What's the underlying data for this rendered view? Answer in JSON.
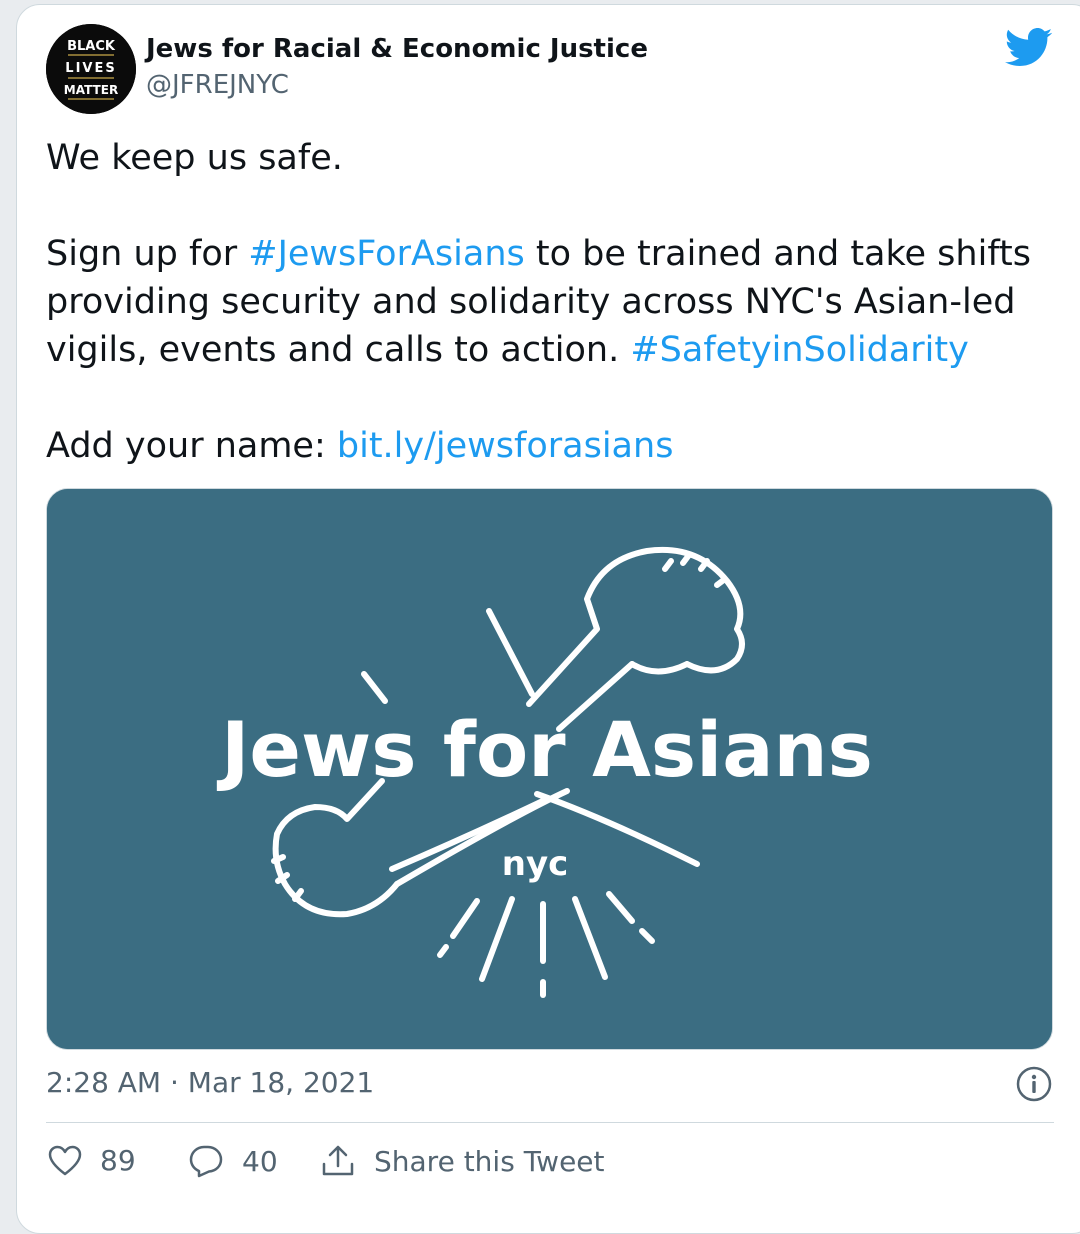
{
  "tweet": {
    "author_name": "Jews for Racial & Economic Justice",
    "author_handle": "@JFREJNYC",
    "avatar_text": [
      "BLACK",
      "LIVES",
      "MATTER"
    ],
    "line1": "We keep us safe.",
    "para2_pre": "Sign up for ",
    "para2_hashtag1": "#JewsForAsians",
    "para2_mid": " to be trained and take shifts",
    "para2_line2": "providing security and solidarity across NYC's Asian-led",
    "para2_line3_pre": "vigils, events and calls to action. ",
    "para2_hashtag2": "#SafetyinSolidarity",
    "add_name_label": "Add your name: ",
    "add_name_link": "bit.ly/jewsforasians",
    "image": {
      "title": "Jews for Asians",
      "subtitle": "nyc",
      "background": "#3b6d82"
    },
    "timestamp": "2:28 AM · Mar 18, 2021",
    "likes": "89",
    "replies": "40",
    "share_label": "Share this Tweet"
  },
  "colors": {
    "link": "#1d9bf0",
    "twitter_blue": "#1d9bf0",
    "muted": "#536471",
    "text": "#0f1419"
  },
  "icons": [
    "twitter-bird-icon",
    "info-icon",
    "heart-icon",
    "reply-bubble-icon",
    "share-icon"
  ]
}
